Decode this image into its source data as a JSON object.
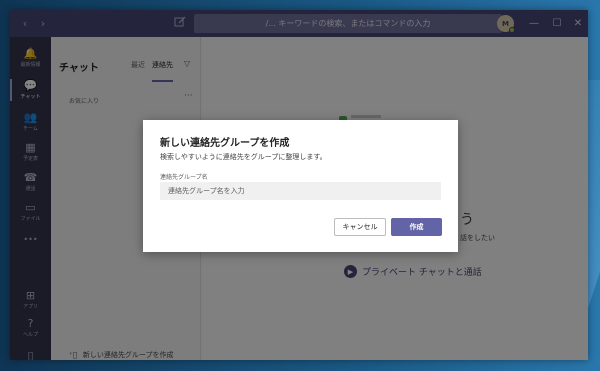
{
  "titlebar": {
    "search_placeholder": "/... キーワードの検索、またはコマンドの入力",
    "avatar_initials": "M",
    "nav_back": "‹",
    "nav_forward": "›",
    "minimize": "—",
    "maximize": "☐",
    "close": "✕"
  },
  "rail": {
    "items": [
      {
        "label": "最新情報",
        "icon": "bell-icon",
        "glyph": "🔔"
      },
      {
        "label": "チャット",
        "icon": "chat-icon",
        "glyph": "💬"
      },
      {
        "label": "チーム",
        "icon": "teams-icon",
        "glyph": "👥"
      },
      {
        "label": "予定表",
        "icon": "calendar-icon",
        "glyph": "▦"
      },
      {
        "label": "通話",
        "icon": "phone-icon",
        "glyph": "☎"
      },
      {
        "label": "ファイル",
        "icon": "file-icon",
        "glyph": "▭"
      },
      {
        "label": "...",
        "icon": "more-icon",
        "glyph": "•••"
      },
      {
        "label": "アプリ",
        "icon": "apps-icon",
        "glyph": "⊞"
      },
      {
        "label": "ヘルプ",
        "icon": "help-icon",
        "glyph": "?"
      },
      {
        "label": "",
        "icon": "device-icon",
        "glyph": "▯"
      }
    ]
  },
  "listpane": {
    "title": "チャット",
    "tab_recent": "最近",
    "tab_contacts": "連絡先",
    "section_favorites": "お気に入り",
    "more": "···",
    "add_group": "新しい連絡先グループを作成"
  },
  "main": {
    "big_fragment": "う",
    "sub_fragment": "話をしたい",
    "private_call": "プライベート チャットと通話"
  },
  "dialog": {
    "title": "新しい連絡先グループを作成",
    "description": "検索しやすいように連絡先をグループに整理します。",
    "field_label": "連絡先グループ名",
    "field_placeholder": "連絡先グループ名を入力",
    "field_value": "",
    "cancel_label": "キャンセル",
    "create_label": "作成"
  },
  "colors": {
    "accent": "#6264a7",
    "titlebar": "#464775",
    "rail": "#33344a"
  }
}
